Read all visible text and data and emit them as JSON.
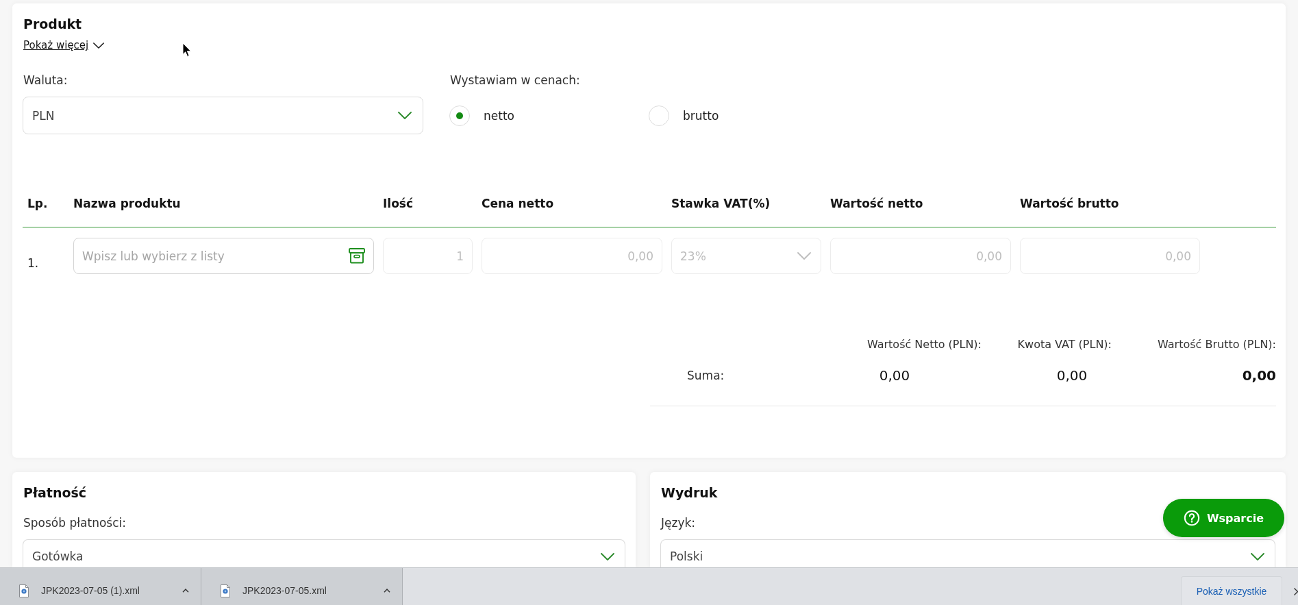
{
  "product": {
    "title": "Produkt",
    "show_more": {
      "label": "Pokaż więcej",
      "expanded": false
    },
    "currency": {
      "label": "Waluta:",
      "value": "PLN"
    },
    "price_basis": {
      "label": "Wystawiam w cenach:",
      "options": [
        {
          "label": "netto",
          "selected": true
        },
        {
          "label": "brutto",
          "selected": false
        }
      ]
    },
    "table": {
      "columns": [
        "Lp.",
        "Nazwa produktu",
        "Ilość",
        "Cena netto",
        "Stawka VAT(%)",
        "Wartość netto",
        "Wartość brutto"
      ],
      "rows": [
        {
          "cells": [
            {
              "kind": "number",
              "text": "1."
            },
            {
              "kind": "picker",
              "placeholder": "Wpisz lub wybierz z listy",
              "disabled": false
            },
            {
              "kind": "input",
              "value": "1",
              "disabled": true
            },
            {
              "kind": "input",
              "value": "0,00",
              "disabled": true
            },
            {
              "kind": "select",
              "value": "23%",
              "disabled": true
            },
            {
              "kind": "input",
              "value": "0,00",
              "disabled": true
            },
            {
              "kind": "input",
              "value": "0,00",
              "disabled": true
            }
          ]
        }
      ]
    },
    "totals": {
      "label": "Suma:",
      "columns": [
        {
          "header": "Wartość Netto (PLN):",
          "value": "0,00",
          "emphasized": false
        },
        {
          "header": "Kwota VAT (PLN):",
          "value": "0,00",
          "emphasized": false
        },
        {
          "header": "Wartość Brutto (PLN):",
          "value": "0,00",
          "emphasized": true
        }
      ]
    }
  },
  "payment": {
    "title": "Płatność",
    "method": {
      "label": "Sposób płatności:",
      "value": "Gotówka"
    }
  },
  "printout": {
    "title": "Wydruk",
    "language": {
      "label": "Język:",
      "value": "Polski"
    }
  },
  "support_button": {
    "label": "Wsparcie"
  },
  "downloads": {
    "items": [
      {
        "filename": "JPK2023-07-05 (1).xml"
      },
      {
        "filename": "JPK2023-07-05.xml"
      }
    ],
    "show_all": "Pokaż wszystkie"
  }
}
